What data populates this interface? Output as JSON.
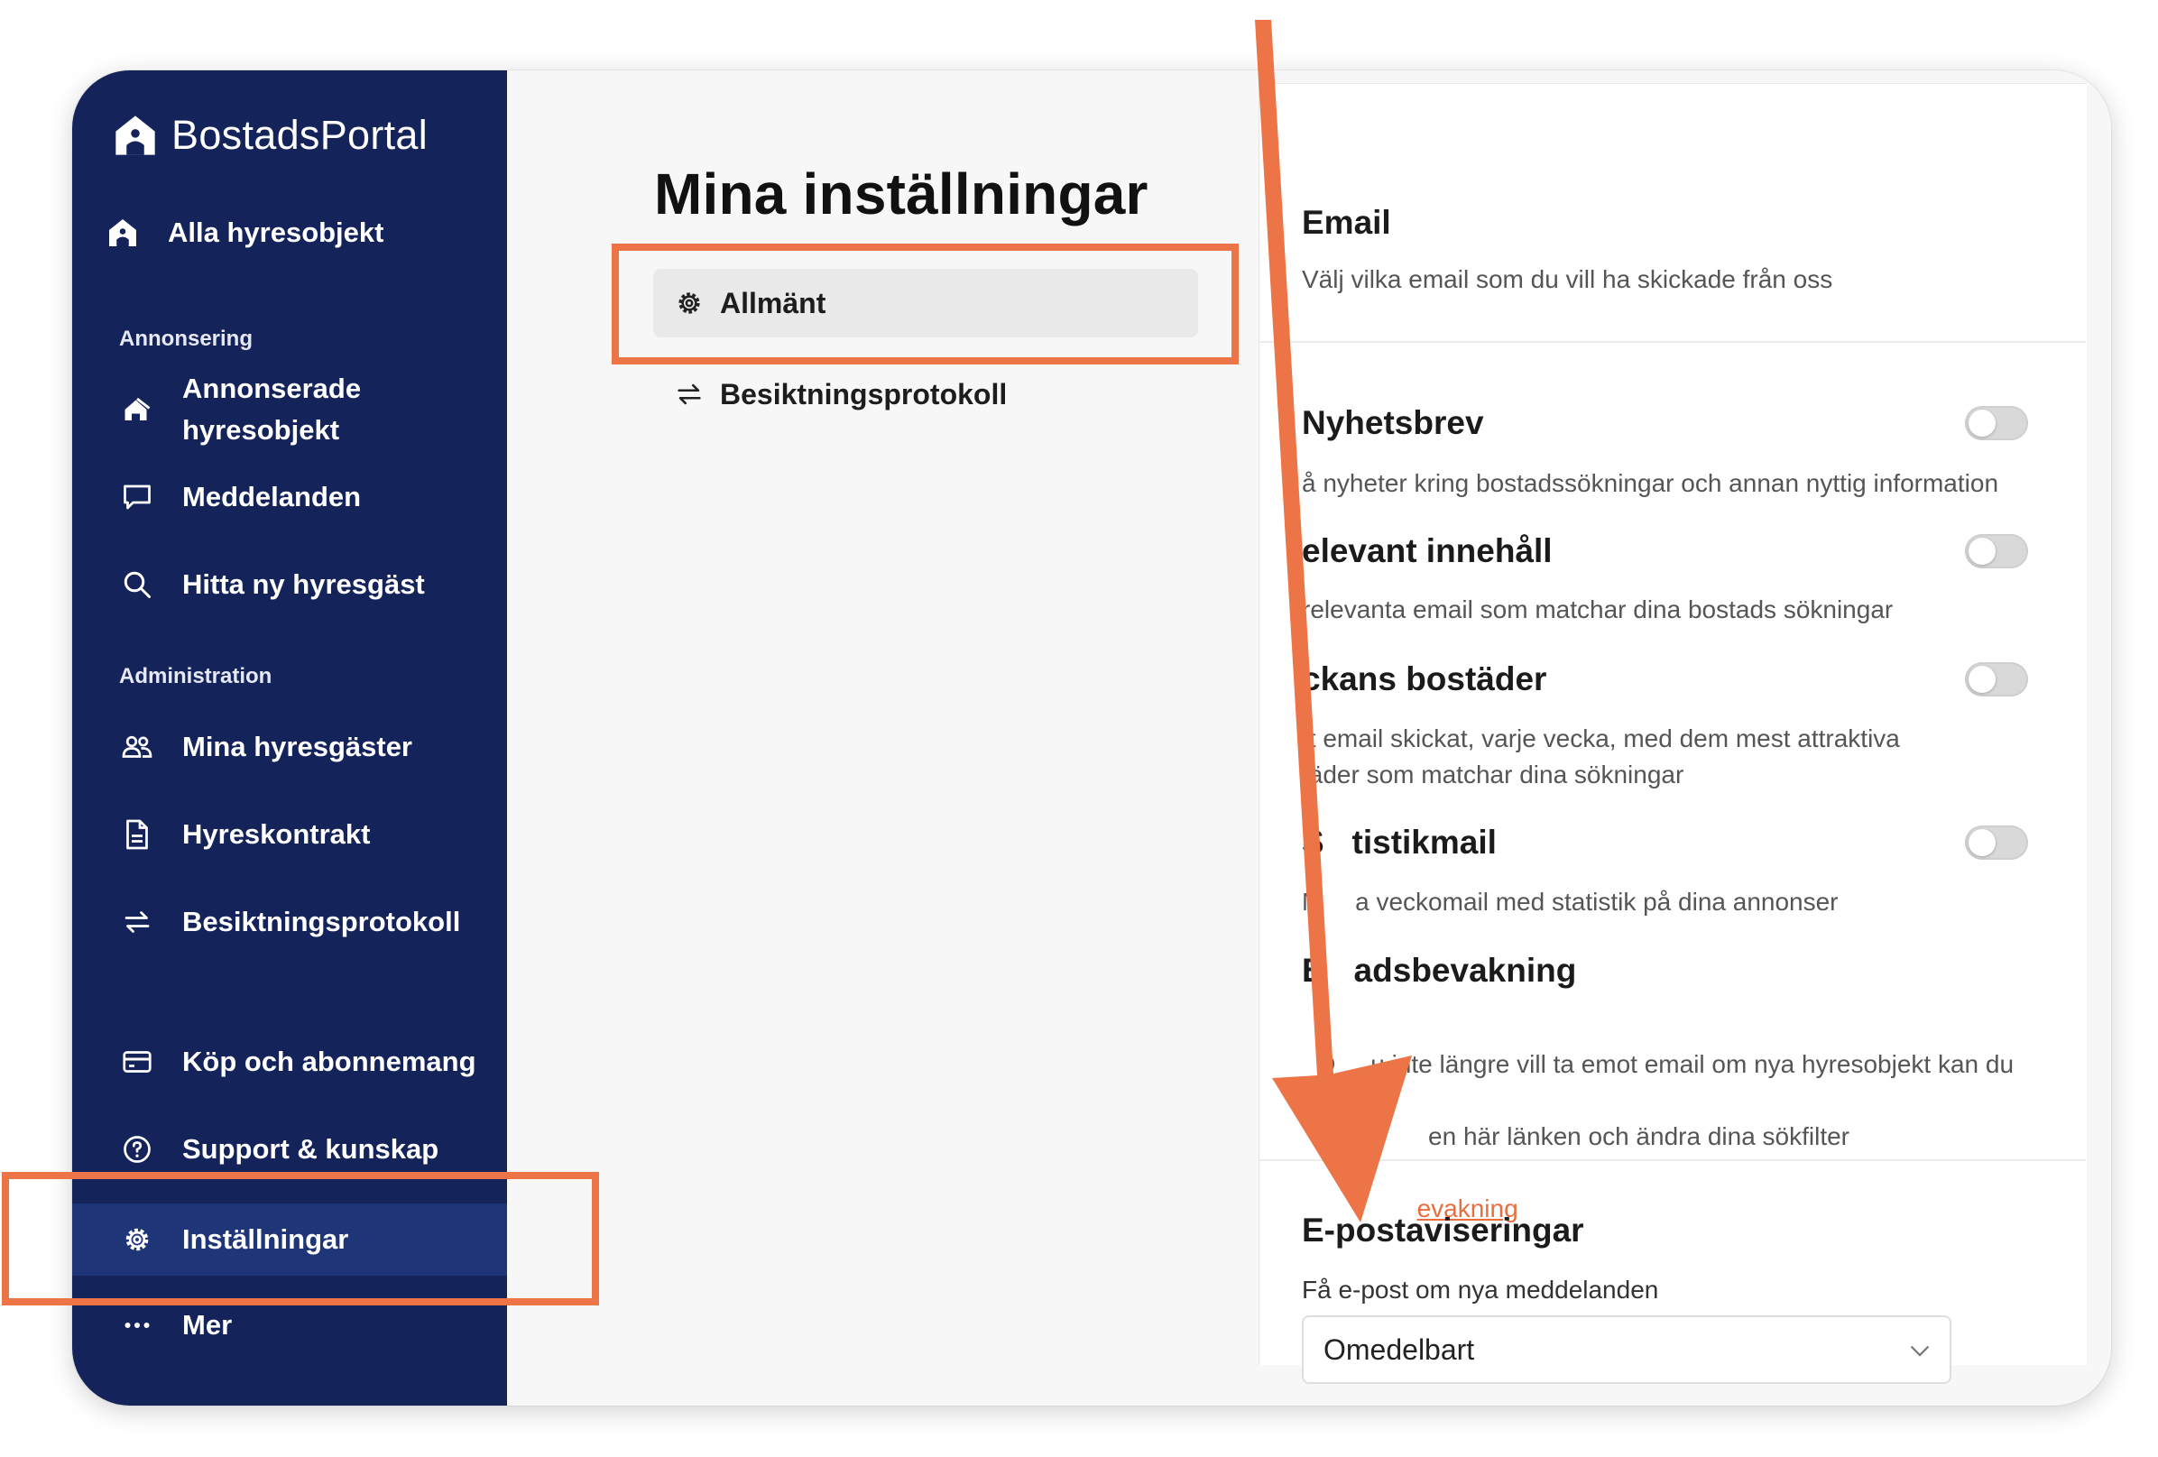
{
  "app": {
    "brand": "BostadsPortal"
  },
  "sidebar": {
    "all_listings": "Alla hyresobjekt",
    "section_ads": "Annonsering",
    "listed_line1": "Annonserade",
    "listed_line2": "hyresobjekt",
    "messages": "Meddelanden",
    "find_tenant": "Hitta ny hyresgäst",
    "section_admin": "Administration",
    "my_tenants": "Mina hyresgäster",
    "contract": "Hyreskontrakt",
    "inspection": "Besiktningsprotokoll",
    "purchases": "Köp och abonnemang",
    "support": "Support & kunskap",
    "settings": "Inställningar",
    "more": "Mer"
  },
  "settings_page": {
    "title": "Mina inställningar",
    "tabs": [
      {
        "label": "Allmänt",
        "selected": true
      },
      {
        "label": "Besiktningsprotokoll",
        "selected": false
      }
    ]
  },
  "email_section": {
    "heading": "Email",
    "description": "Välj vilka email som du vill ha skickade från oss",
    "options": [
      {
        "title": "Nyhetsbrev",
        "description": "å nyheter kring bostadssökningar och annan nyttig information",
        "enabled": false
      },
      {
        "title": "elevant innehåll",
        "description": "relevanta email som matchar dina bostads sökningar",
        "enabled": false
      },
      {
        "title": "ckans bostäder",
        "description_line1": "tt email skickat, varje vecka, med dem mest attraktiva",
        "description_line2": "täder som matchar dina sökningar",
        "enabled": false
      },
      {
        "title": "S   tistikmail",
        "description": "N     a veckomail med statistik på dina annonser",
        "enabled": false
      }
    ],
    "watch": {
      "title": "B   adsbevakning",
      "line1": "O     u inte längre vill ta emot email om nya hyresobjekt kan du",
      "line2": "g              en här länken och ändra dina sökfilter",
      "link_text": "evakning"
    }
  },
  "notifications": {
    "heading": "E-postaviseringar",
    "label": "Få e-post om nya meddelanden",
    "selected": "Omedelbart"
  },
  "colors": {
    "sidebar": "#14235a",
    "highlight": "#ec7446",
    "arrow": "#ec7446"
  }
}
